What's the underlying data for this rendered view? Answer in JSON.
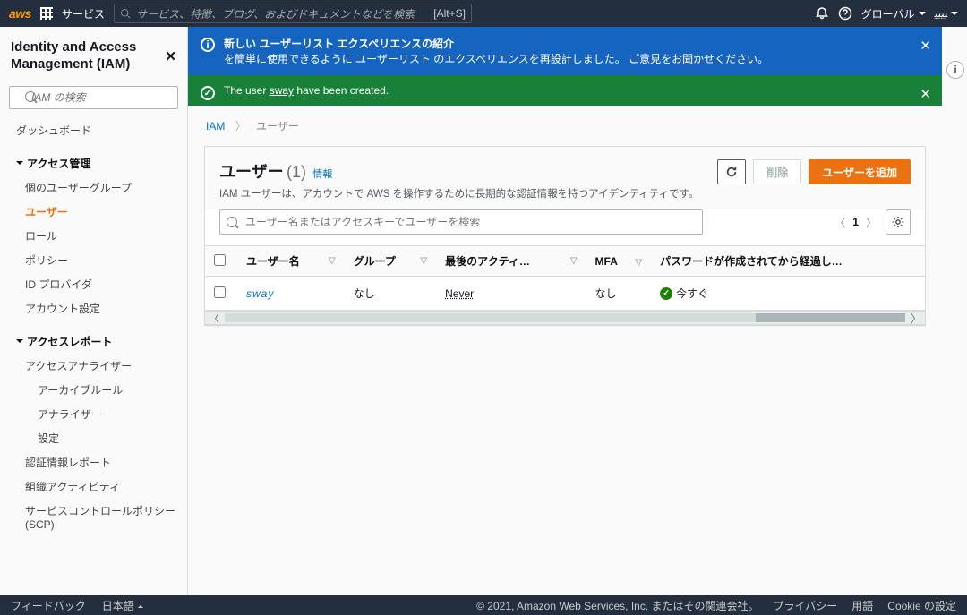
{
  "top": {
    "logo": "aws",
    "services_label": "サービス",
    "search_placeholder": "サービス、特徴、ブログ、およびドキュメントなどを検索",
    "search_shortcut": "[Alt+S]",
    "region": "グローバル",
    "account": "ﯿﯿﯿﯿ"
  },
  "sidebar": {
    "title": "Identity and Access Management (IAM)",
    "search_placeholder": "IAM の検索",
    "dashboard": "ダッシュボード",
    "section_access": "アクセス管理",
    "items_access": [
      "個のユーザーグループ",
      "ユーザー",
      "ロール",
      "ポリシー",
      "ID プロバイダ",
      "アカウント設定"
    ],
    "active_index": 1,
    "section_report": "アクセスレポート",
    "items_report": [
      "アクセスアナライザー",
      "アーカイブルール",
      "アナライザー",
      "設定",
      "認証情報レポート",
      "組織アクティビティ",
      "サービスコントロールポリシー (SCP)"
    ]
  },
  "banner_info": {
    "title": "新しい ユーザーリスト エクスペリエンスの紹介",
    "body_pre": "を簡単に使用できるように ユーザーリスト のエクスペリエンスを再設計しました。 ",
    "link": "ご意見をお聞かせください",
    "body_post": "。"
  },
  "banner_ok": {
    "pre": "The user ",
    "user": "sway",
    "post": " have been created."
  },
  "crumbs": {
    "root": "IAM",
    "leaf": "ユーザー"
  },
  "panel": {
    "title": "ユーザー",
    "count": "(1)",
    "info": "情報",
    "desc": "IAM ユーザーは、アカウントで AWS を操作するために長期的な認証情報を持つアイデンティティです。",
    "btn_delete": "削除",
    "btn_add": "ユーザーを追加",
    "search_placeholder": "ユーザー名またはアクセスキーでユーザーを検索",
    "page": "1",
    "columns": [
      "",
      "ユーザー名",
      "グループ",
      "最後のアクティ…",
      "MFA",
      "パスワードが作成されてから経過し…"
    ],
    "row": {
      "user": "sway",
      "group": "なし",
      "last": "Never",
      "mfa": "なし",
      "pwd": "今すぐ"
    }
  },
  "footer": {
    "feedback": "フィードバック",
    "lang": "日本語",
    "copy": "© 2021, Amazon Web Services, Inc. またはその関連会社。",
    "privacy": "プライバシー",
    "terms": "用語",
    "cookie": "Cookie の設定"
  }
}
